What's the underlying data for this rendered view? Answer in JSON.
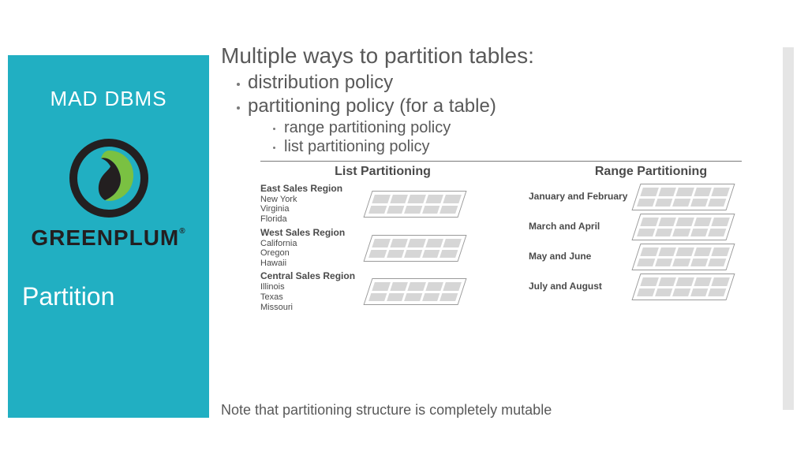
{
  "sidebar": {
    "title": "MAD DBMS",
    "brand": "GREENPLUM",
    "subtitle": "Partition"
  },
  "content": {
    "main_heading": "Multiple ways to partition tables:",
    "bullets": {
      "b1": "distribution policy",
      "b2": "partitioning policy (for a table)",
      "sub1": "range partitioning policy",
      "sub2": "list partitioning policy"
    }
  },
  "diagram": {
    "col1_title": "List Partitioning",
    "col2_title": "Range Partitioning",
    "list": [
      {
        "title": "East Sales Region",
        "items": "New York\nVirginia\nFlorida"
      },
      {
        "title": "West Sales Region",
        "items": "California\nOregon\nHawaii"
      },
      {
        "title": "Central Sales Region",
        "items": "Illinois\nTexas\nMissouri"
      }
    ],
    "range": [
      {
        "title": "January and February"
      },
      {
        "title": "March and April"
      },
      {
        "title": "May and June"
      },
      {
        "title": "July and August"
      }
    ]
  },
  "note": "Note that partitioning structure is completely mutable"
}
